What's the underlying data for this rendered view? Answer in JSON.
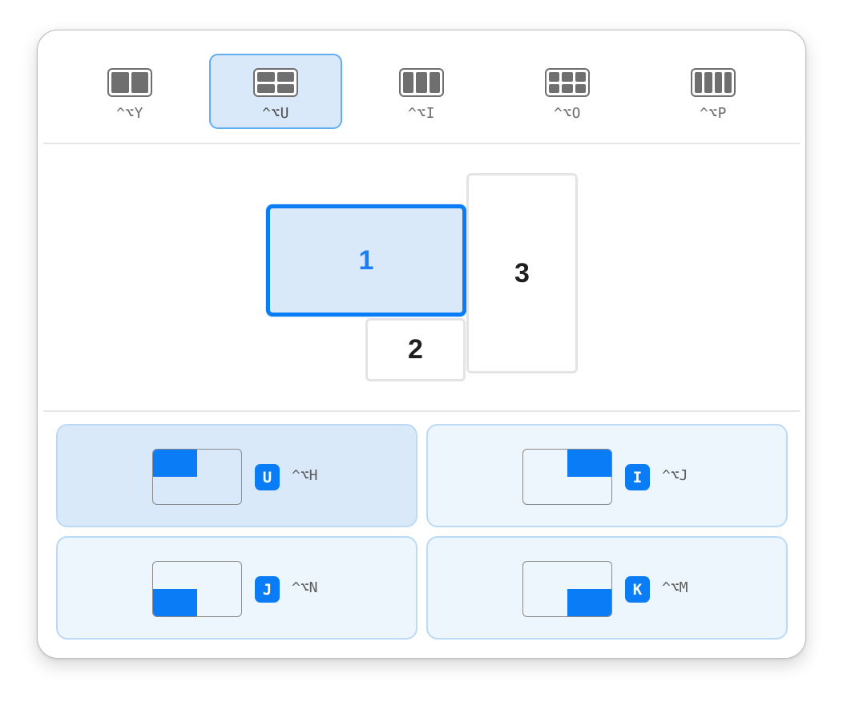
{
  "layouts": [
    {
      "id": "two-columns",
      "shortcut": "^⌥Y",
      "selected": false
    },
    {
      "id": "grid-2x2",
      "shortcut": "^⌥U",
      "selected": true
    },
    {
      "id": "three-columns",
      "shortcut": "^⌥I",
      "selected": false
    },
    {
      "id": "grid-3x2",
      "shortcut": "^⌥O",
      "selected": false
    },
    {
      "id": "four-columns",
      "shortcut": "^⌥P",
      "selected": false
    }
  ],
  "screens": [
    {
      "label": "1",
      "active": true
    },
    {
      "label": "2",
      "active": false
    },
    {
      "label": "3",
      "active": false
    }
  ],
  "positions": [
    {
      "quadrant": "top-left",
      "key": "U",
      "shortcut": "^⌥H",
      "selected": true
    },
    {
      "quadrant": "top-right",
      "key": "I",
      "shortcut": "^⌥J",
      "selected": false
    },
    {
      "quadrant": "bottom-left",
      "key": "J",
      "shortcut": "^⌥N",
      "selected": false
    },
    {
      "quadrant": "bottom-right",
      "key": "K",
      "shortcut": "^⌥M",
      "selected": false
    }
  ],
  "colors": {
    "accent": "#0a7cf5",
    "selected_bg": "#d9e9fa",
    "tile_bg": "#edf5fd",
    "icon_gray": "#6f6f6f"
  }
}
